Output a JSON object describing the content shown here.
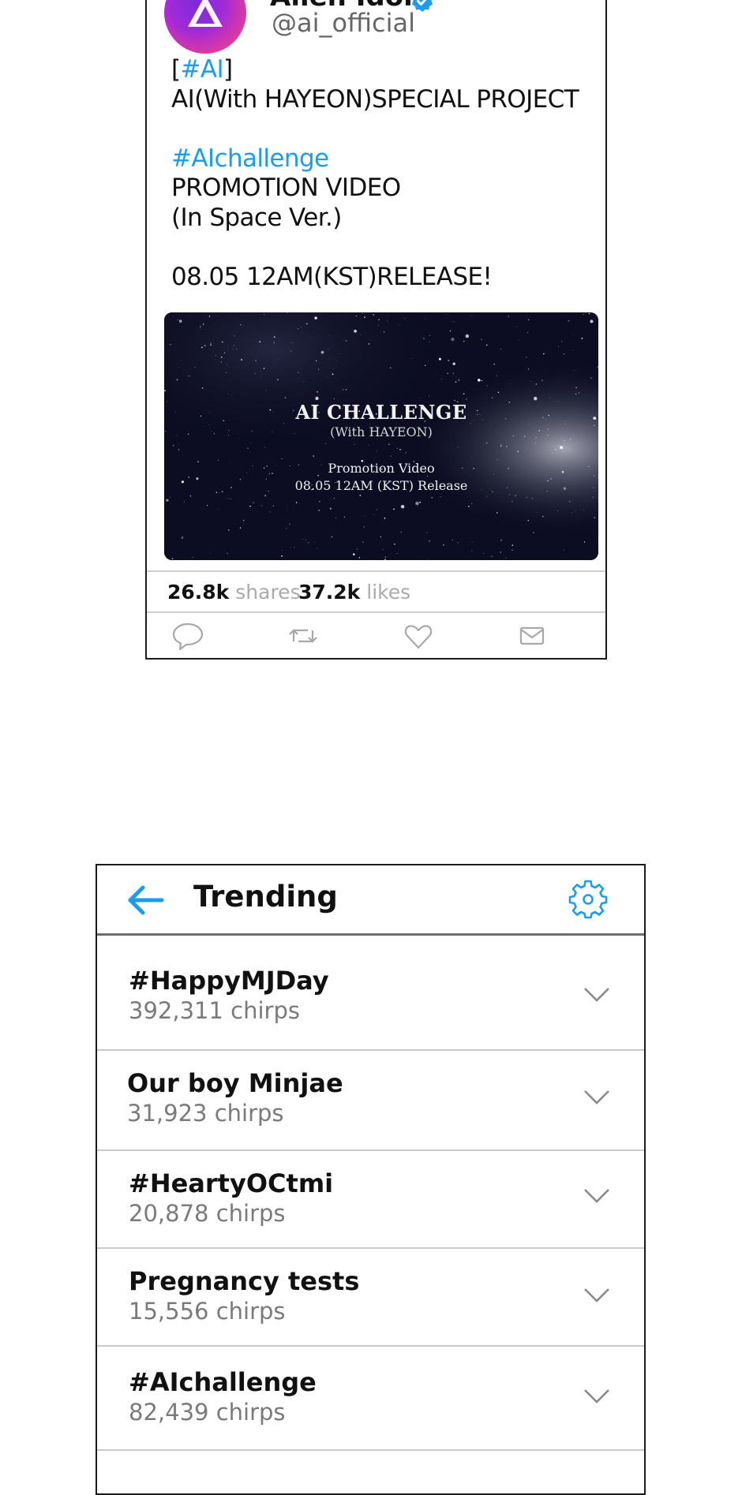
{
  "tweet": {
    "display_name": "Alien Idol",
    "handle": "@ai_official",
    "avatar_label": "AI",
    "body": {
      "line1_open": "[",
      "line1_tag": "#AI",
      "line1_close": "]",
      "line2": "AI(With HAYEON)SPECIAL PROJECT",
      "line3_tag": "#AIchallenge",
      "line4": "PROMOTION VIDEO",
      "line5": "(In Space Ver.)",
      "line6": "08.05 12AM(KST)RELEASE!"
    },
    "media": {
      "title": "AI CHALLENGE",
      "subtitle": "(With HAYEON)",
      "promo": "Promotion Video",
      "date": "08.05 12AM (KST) Release"
    },
    "stats": {
      "shares_count": "26.8k",
      "shares_label": "shares",
      "likes_count": "37.2k",
      "likes_label": "likes"
    },
    "actions": [
      "reply-icon",
      "rechirp-icon",
      "like-icon",
      "message-icon"
    ]
  },
  "trending": {
    "title": "Trending",
    "items": [
      {
        "name": "#HappyMJDay",
        "count": "392,311 chirps"
      },
      {
        "name": "Our boy Minjae",
        "count": "31,923 chirps"
      },
      {
        "name": "#HeartyOCtmi",
        "count": "20,878 chirps"
      },
      {
        "name": "Pregnancy tests",
        "count": "15,556 chirps"
      },
      {
        "name": "#AIchallenge",
        "count": "82,439 chirps"
      }
    ]
  },
  "colors": {
    "link": "#1d9bf0",
    "border": "#1a1a1a",
    "muted": "#7a7a7a"
  }
}
